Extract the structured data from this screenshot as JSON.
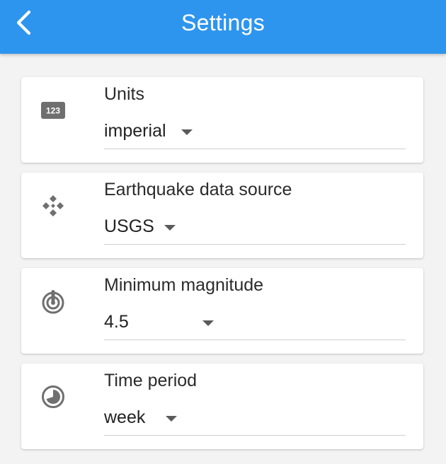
{
  "appbar": {
    "title": "Settings",
    "background": "#2e95ee",
    "back_icon": "chevron-left-icon"
  },
  "settings": [
    {
      "label": "Units",
      "value": "imperial",
      "icon": "numeric-123-icon"
    },
    {
      "label": "Earthquake data source",
      "value": "USGS",
      "icon": "data-source-icon"
    },
    {
      "label": "Minimum magnitude",
      "value": "4.5",
      "icon": "seismic-target-icon"
    },
    {
      "label": "Time period",
      "value": "week",
      "icon": "clock-pie-icon"
    }
  ]
}
